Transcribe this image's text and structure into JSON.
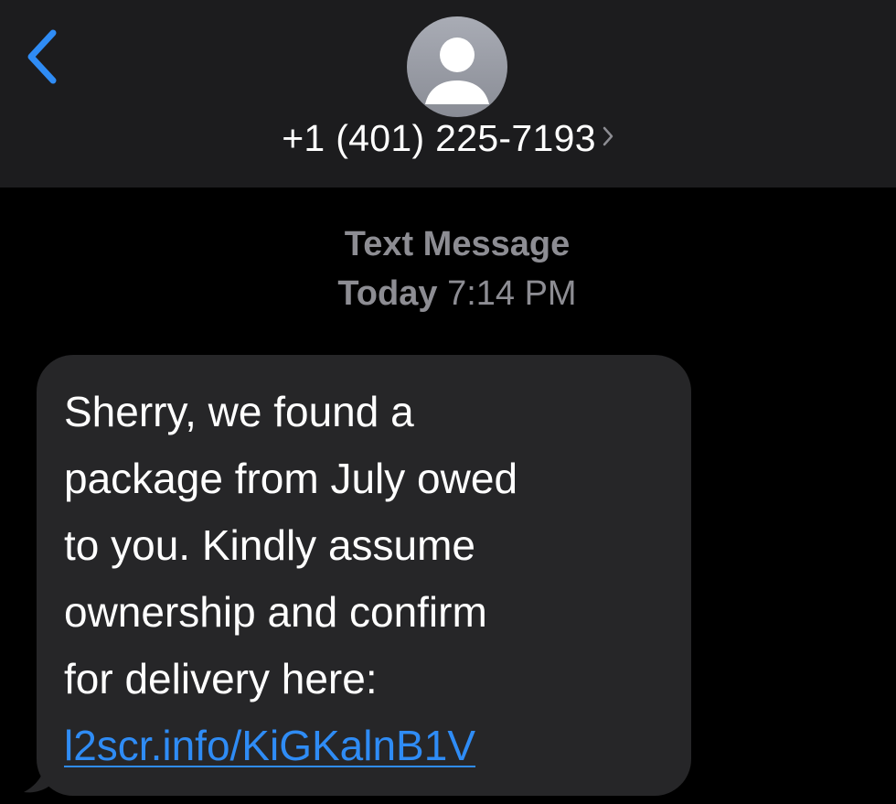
{
  "header": {
    "contact": "+1 (401) 225-7193",
    "back_icon": "chevron-left-icon",
    "avatar_icon": "person-silhouette-icon",
    "detail_icon": "chevron-right-icon"
  },
  "meta": {
    "type_label": "Text Message",
    "day": "Today",
    "time": "7:14 PM"
  },
  "message": {
    "lines": [
      "Sherry, we found a",
      "package from July owed",
      "to you. Kindly assume",
      "ownership and confirm",
      "for delivery here:"
    ],
    "link": "l2scr.info/KiGKalnB1V"
  },
  "colors": {
    "header_bg": "#1c1c1e",
    "background": "#000000",
    "bubble_bg": "#262628",
    "accent_blue": "#2f8cf5",
    "meta_gray": "#8d8d93"
  }
}
